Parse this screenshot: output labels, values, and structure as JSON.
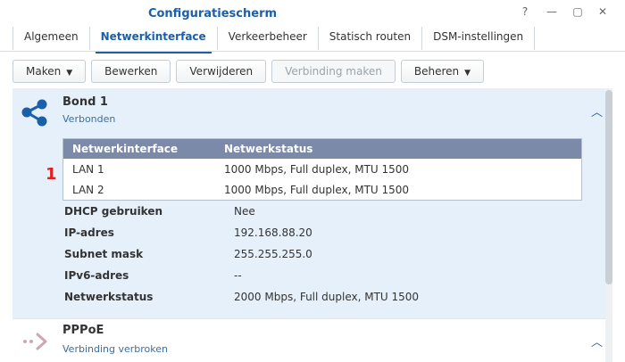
{
  "window": {
    "title": "Configuratiescherm",
    "controls": [
      "?",
      "—",
      "▢",
      "✕"
    ]
  },
  "tabs": [
    {
      "label": "Algemeen",
      "active": false
    },
    {
      "label": "Netwerkinterface",
      "active": true
    },
    {
      "label": "Verkeerbeheer",
      "active": false
    },
    {
      "label": "Statisch routen",
      "active": false
    },
    {
      "label": "DSM-instellingen",
      "active": false
    }
  ],
  "toolbar": {
    "create_label": "Maken",
    "edit_label": "Bewerken",
    "delete_label": "Verwijderen",
    "connect_label": "Verbinding maken",
    "manage_label": "Beheren"
  },
  "bond": {
    "name": "Bond 1",
    "status": "Verbonden",
    "table": {
      "headers": [
        "Netwerkinterface",
        "Netwerkstatus"
      ],
      "rows": [
        [
          "LAN 1",
          "1000 Mbps, Full duplex, MTU 1500"
        ],
        [
          "LAN 2",
          "1000 Mbps, Full duplex, MTU 1500"
        ]
      ]
    },
    "badge": "1",
    "props": [
      {
        "label": "DHCP gebruiken",
        "value": "Nee"
      },
      {
        "label": "IP-adres",
        "value": "192.168.88.20"
      },
      {
        "label": "Subnet mask",
        "value": "255.255.255.0"
      },
      {
        "label": "IPv6-adres",
        "value": "--"
      },
      {
        "label": "Netwerkstatus",
        "value": "2000 Mbps, Full duplex, MTU 1500"
      }
    ]
  },
  "pppoe": {
    "name": "PPPoE",
    "status": "Verbinding verbroken"
  },
  "icons": {
    "bond": "share-network-icon",
    "pppoe": "dotted-arrow-icon",
    "expand": "chevron-up-icon"
  },
  "colors": {
    "accent": "#1a5fa8",
    "selected_bg": "#e6f0fb",
    "table_header": "#7a8aa8",
    "badge": "#e02020"
  }
}
